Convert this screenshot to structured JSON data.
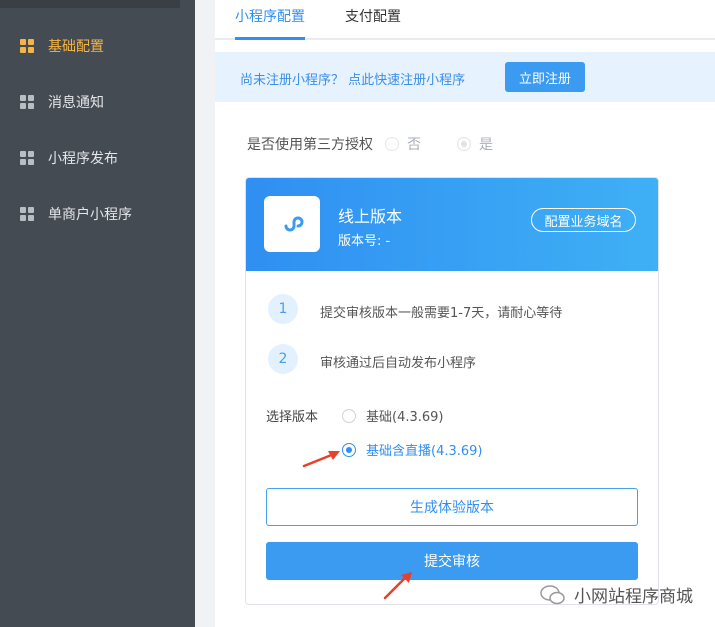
{
  "sidebar": {
    "items": [
      {
        "label": "基础配置",
        "active": true
      },
      {
        "label": "消息通知",
        "active": false
      },
      {
        "label": "小程序发布",
        "active": false
      },
      {
        "label": "单商户小程序",
        "active": false
      }
    ]
  },
  "tabs": [
    {
      "label": "小程序配置",
      "active": true
    },
    {
      "label": "支付配置",
      "active": false
    }
  ],
  "banner": {
    "text": "尚未注册小程序？ 点此快速注册小程序",
    "button": "立即注册"
  },
  "auth": {
    "label": "是否使用第三方授权",
    "options": [
      {
        "label": "否",
        "checked": false
      },
      {
        "label": "是",
        "checked": true
      }
    ]
  },
  "card": {
    "title": "线上版本",
    "version_text": "版本号: -",
    "domain_button": "配置业务域名",
    "steps": [
      {
        "num": "1",
        "text": "提交审核版本一般需要1-7天，请耐心等待"
      },
      {
        "num": "2",
        "text": "审核通过后自动发布小程序"
      }
    ],
    "version_select_label": "选择版本",
    "version_options": [
      {
        "label": "基础(4.3.69)",
        "selected": false
      },
      {
        "label": "基础含直播(4.3.69)",
        "selected": true
      }
    ],
    "experience_button": "生成体验版本",
    "submit_button": "提交审核"
  },
  "watermark": "小网站程序商城",
  "colors": {
    "sidebar_bg": "#454b52",
    "active_nav": "#f5b544",
    "primary": "#2f8ff2",
    "arrow": "#e8402a"
  }
}
